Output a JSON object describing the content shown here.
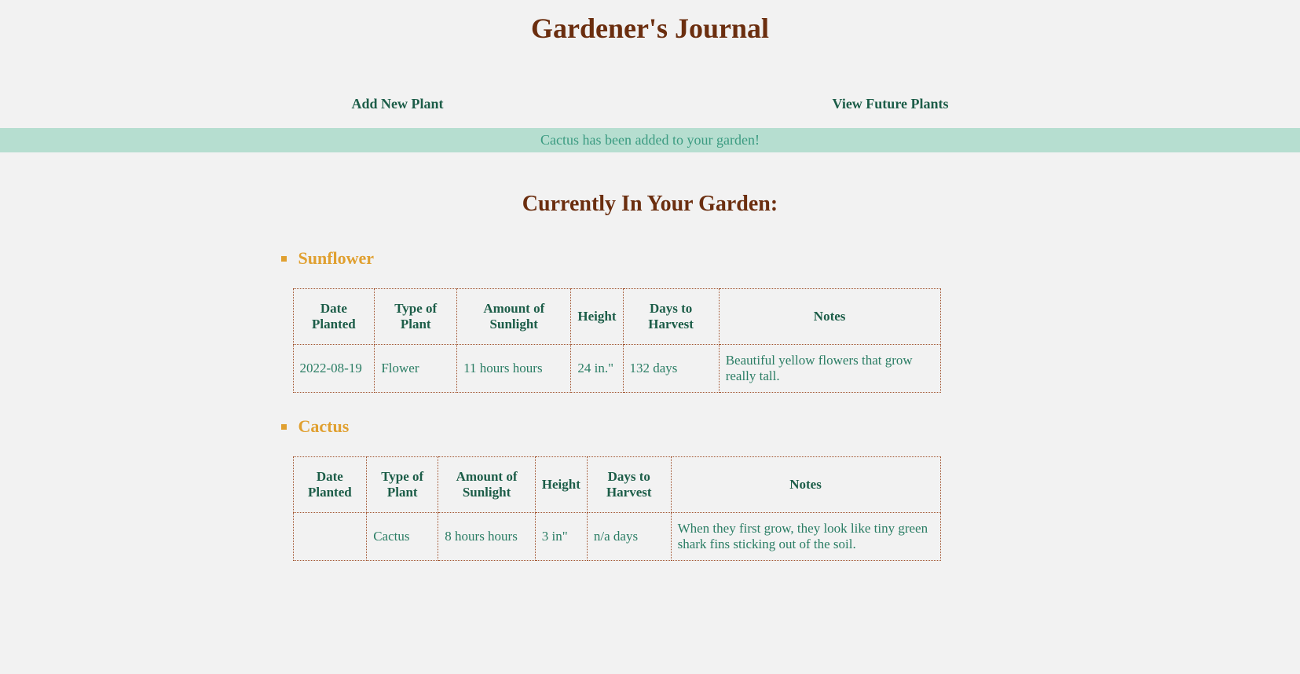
{
  "page_title": "Gardener's Journal",
  "nav": {
    "add_new": "Add New Plant",
    "view_future": "View Future Plants"
  },
  "flash_message": "Cactus has been added to your garden!",
  "section_title": "Currently In Your Garden:",
  "table_headers": {
    "date_planted": "Date Planted",
    "type_of_plant": "Type of Plant",
    "amount_of_sunlight": "Amount of Sunlight",
    "height": "Height",
    "days_to_harvest": "Days to Harvest",
    "notes": "Notes"
  },
  "plants": [
    {
      "name": "Sunflower",
      "date_planted": "2022-08-19",
      "type_of_plant": "Flower",
      "amount_of_sunlight": "11 hours hours",
      "height": "24 in.\"",
      "days_to_harvest": "132 days",
      "notes": "Beautiful yellow flowers that grow really tall."
    },
    {
      "name": "Cactus",
      "date_planted": "",
      "type_of_plant": "Cactus",
      "amount_of_sunlight": "8 hours hours",
      "height": "3 in\"",
      "days_to_harvest": "n/a days",
      "notes": "When they first grow, they look like tiny green shark fins sticking out of the soil."
    }
  ]
}
